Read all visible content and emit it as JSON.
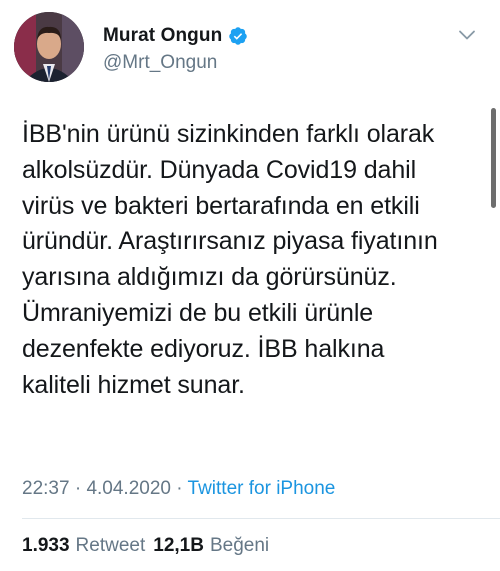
{
  "author": {
    "display_name": "Murat Ongun",
    "handle": "@Mrt_Ongun",
    "verified": true,
    "avatar_icon": "user-avatar"
  },
  "tweet": {
    "text": "İBB'nin ürünü sizinkinden farklı olarak\nalkolsüzdür. Dünyada Covid19 dahil\nvirüs ve bakteri bertarafında en etkili\nüründür. Araştırırsanız piyasa fiyatının\nyarısına aldığımızı da görürsünüz.\nÜmraniyemizi de bu etkili ürünle\ndezenfekte ediyoruz. İBB halkına\nkaliteli hizmet sunar.",
    "time": "22:37",
    "separator": "·",
    "date": "4.04.2020",
    "source": "Twitter for iPhone"
  },
  "stats": {
    "retweets_count": "1.933",
    "retweets_label": "Retweet",
    "likes_count": "12,1B",
    "likes_label": "Beğeni"
  },
  "colors": {
    "text": "#14171a",
    "secondary": "#657786",
    "link": "#1b95e0",
    "verified": "#1da1f2"
  },
  "icons": {
    "verified": "verified-badge-icon",
    "menu": "chevron-down-icon"
  }
}
